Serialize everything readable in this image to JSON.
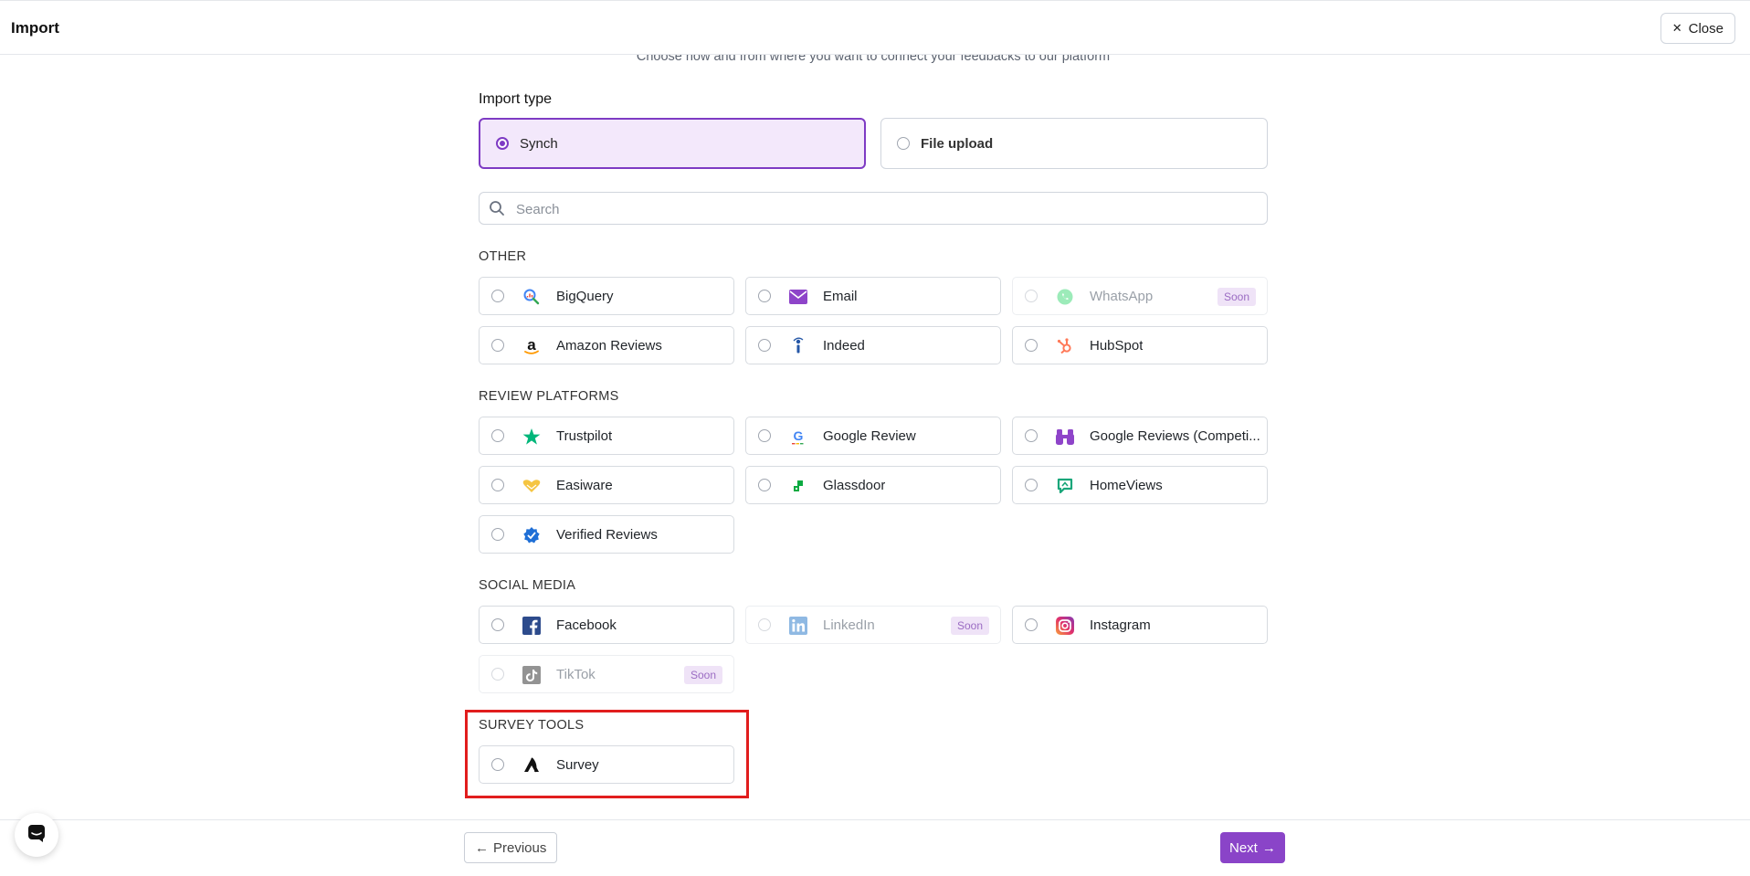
{
  "header": {
    "title": "Import",
    "close_label": "Close"
  },
  "subtitle": "Choose how and from where you want to connect your feedbacks to our platform",
  "import_type": {
    "label": "Import type",
    "options": [
      {
        "label": "Synch",
        "selected": true
      },
      {
        "label": "File upload",
        "selected": false
      }
    ]
  },
  "search": {
    "placeholder": "Search",
    "value": ""
  },
  "sections": [
    {
      "title": "OTHER",
      "items": [
        {
          "name": "BigQuery",
          "icon": "bigquery-icon",
          "soon": false
        },
        {
          "name": "Email",
          "icon": "email-icon",
          "soon": false
        },
        {
          "name": "WhatsApp",
          "icon": "whatsapp-icon",
          "soon": true
        },
        {
          "name": "Amazon Reviews",
          "icon": "amazon-icon",
          "soon": false
        },
        {
          "name": "Indeed",
          "icon": "indeed-icon",
          "soon": false
        },
        {
          "name": "HubSpot",
          "icon": "hubspot-icon",
          "soon": false
        }
      ]
    },
    {
      "title": "REVIEW PLATFORMS",
      "items": [
        {
          "name": "Trustpilot",
          "icon": "trustpilot-icon",
          "soon": false
        },
        {
          "name": "Google Review",
          "icon": "google-icon",
          "soon": false
        },
        {
          "name": "Google Reviews (Competi...",
          "icon": "binoculars-icon",
          "soon": false
        },
        {
          "name": "Easiware",
          "icon": "easiware-icon",
          "soon": false
        },
        {
          "name": "Glassdoor",
          "icon": "glassdoor-icon",
          "soon": false
        },
        {
          "name": "HomeViews",
          "icon": "homeviews-icon",
          "soon": false
        },
        {
          "name": "Verified Reviews",
          "icon": "verified-reviews-icon",
          "soon": false
        }
      ]
    },
    {
      "title": "SOCIAL MEDIA",
      "items": [
        {
          "name": "Facebook",
          "icon": "facebook-icon",
          "soon": false
        },
        {
          "name": "LinkedIn",
          "icon": "linkedin-icon",
          "soon": true
        },
        {
          "name": "Instagram",
          "icon": "instagram-icon",
          "soon": false
        },
        {
          "name": "TikTok",
          "icon": "tiktok-icon",
          "soon": true
        }
      ]
    },
    {
      "title": "SURVEY TOOLS",
      "items": [
        {
          "name": "Survey",
          "icon": "survey-icon",
          "soon": false
        }
      ]
    }
  ],
  "soon_label": "Soon",
  "footer": {
    "previous_label": "Previous",
    "next_label": "Next"
  },
  "colors": {
    "accent": "#7e3bc4",
    "accent_bg": "#f3e8fb",
    "highlight": "#e11d1d",
    "next_button": "#8a44c8"
  }
}
